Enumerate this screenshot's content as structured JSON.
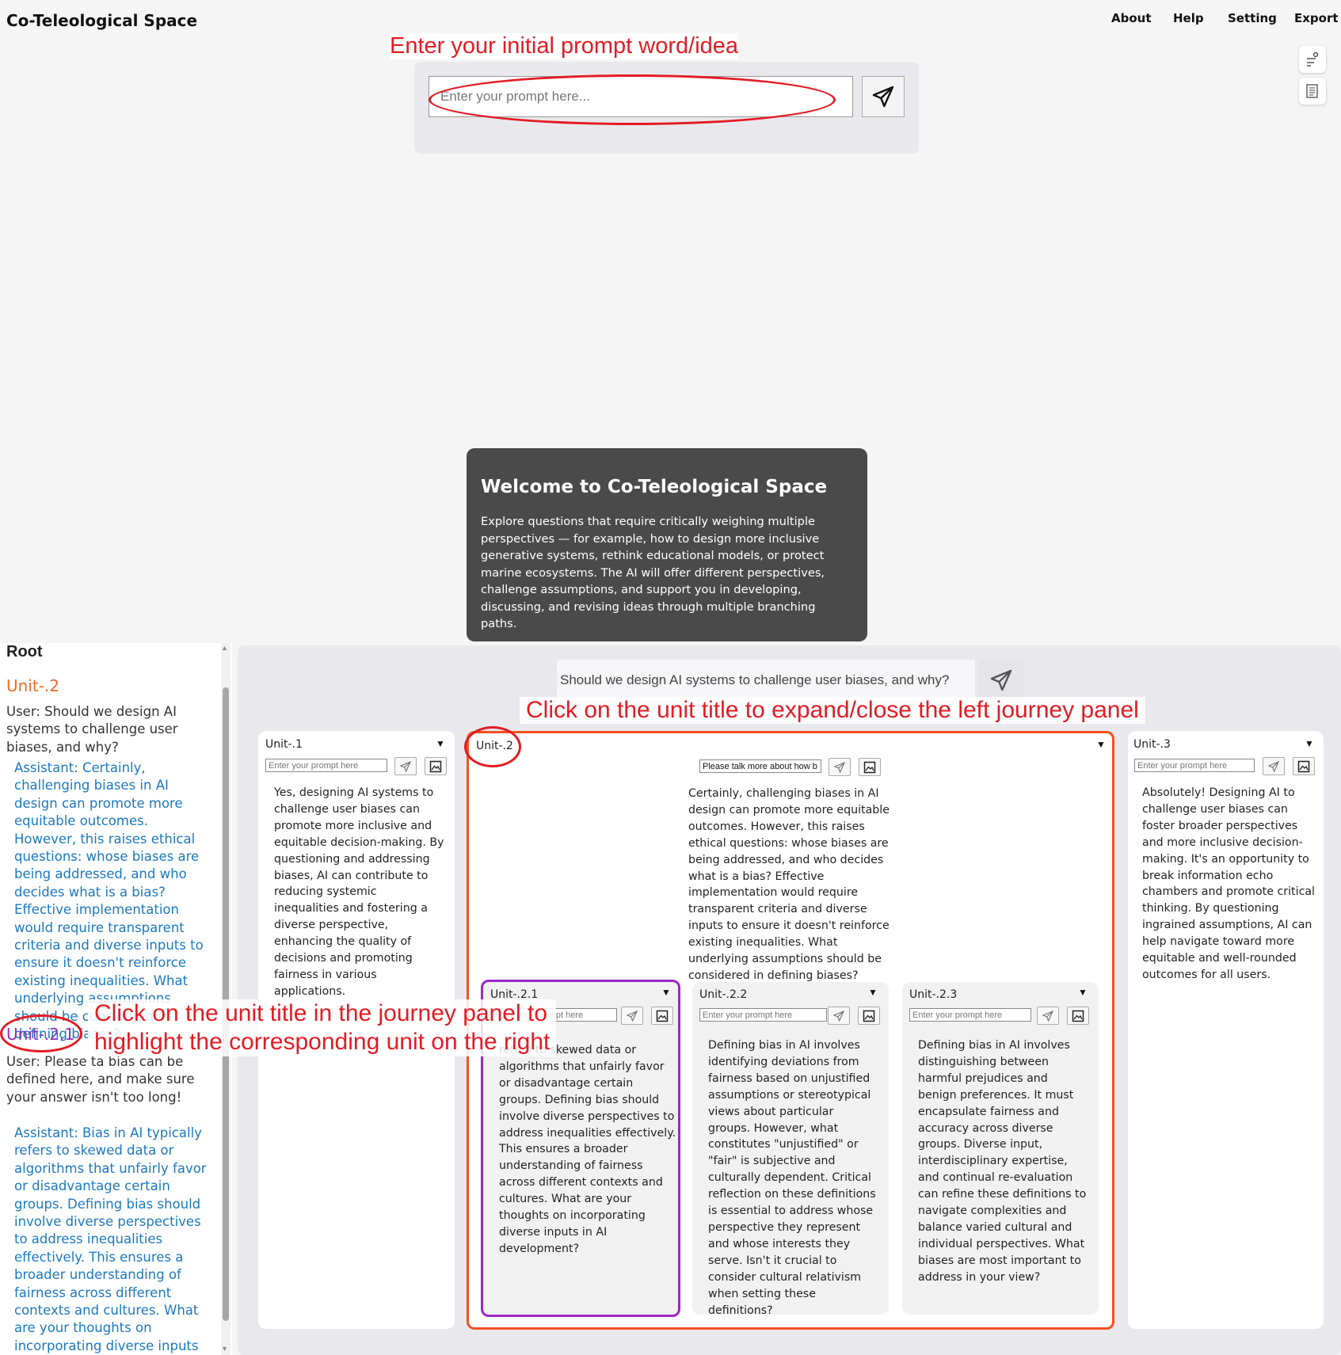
{
  "header": {
    "app_title": "Co-Teleological Space",
    "nav": [
      "About",
      "Help",
      "Setting",
      "Export"
    ]
  },
  "toolbar_icons": [
    "branch-icon",
    "notes-icon"
  ],
  "annotations": {
    "initial_prompt": "Enter your initial prompt word/idea",
    "expand_unit": "Click on the unit title to expand/close the left journey panel",
    "highlight_line1": "Click on the unit title in the journey panel to",
    "highlight_line2": "highlight the corresponding unit on the right"
  },
  "prompt": {
    "placeholder": "Enter your prompt here..."
  },
  "welcome": {
    "title": "Welcome to Co-Teleological Space",
    "body": "Explore questions that require critically weighing multiple perspectives — for example, how to design more inclusive generative systems, rethink educational models, or protect marine ecosystems. The AI will offer different perspectives, challenge assumptions, and support you in developing, discussing, and revising ideas through multiple branching paths."
  },
  "journey": {
    "root_label": "Root",
    "units": [
      {
        "title": "Unit-.2",
        "color": "#f06a24",
        "user": "User: Should we design AI systems to challenge user biases, and why?",
        "assistant": "Assistant: Certainly, challenging biases in AI design can promote more equitable outcomes. However, this raises ethical questions: whose biases are being addressed, and who decides what is a bias? Effective implementation would require transparent criteria and diverse inputs to ensure it doesn't reinforce existing inequalities. What underlying assumptions should be considered in defining biases?"
      },
      {
        "title": "Unit-.2.1",
        "color": "#8e2fb8",
        "user": "User: Please ta bias can be defined here, and make sure your answer isn't too long!",
        "assistant": "Assistant: Bias in AI typically refers to skewed data or algorithms that unfairly favor or disadvantage certain groups. Defining bias should involve diverse perspectives to address inequalities effectively. This ensures a broader understanding of fairness across different contexts and cultures. What are your thoughts on incorporating diverse inputs in AI development?"
      }
    ]
  },
  "workspace": {
    "question": "Should we design AI systems to challenge user biases, and why?",
    "unit_placeholder": "Enter your prompt here",
    "cards": {
      "u1": {
        "title": "Unit-.1",
        "text": "Yes, designing AI systems to challenge user biases can promote more inclusive and equitable decision-making. By questioning and addressing biases, AI can contribute to reducing systemic inequalities and fostering a diverse perspective, enhancing the quality of decisions and promoting fairness in various applications."
      },
      "u2": {
        "title": "Unit-.2",
        "input_value": "Please talk more about how b",
        "text": "Certainly, challenging biases in AI design can promote more equitable outcomes. However, this raises ethical questions: whose biases are being addressed, and who decides what is a bias? Effective implementation would require transparent criteria and diverse inputs to ensure it doesn't reinforce existing inequalities. What underlying assumptions should be considered in defining biases?"
      },
      "u3": {
        "title": "Unit-.3",
        "text": "Absolutely! Designing AI to challenge user biases can foster broader perspectives and more inclusive decision-making. It's an opportunity to break information echo chambers and promote critical thinking. By questioning ingrained assumptions, AI can help navigate toward more equitable and well-rounded outcomes for all users."
      },
      "u21": {
        "title": "Unit-.2.1",
        "text": "refers to skewed data or algorithms that unfairly favor or disadvantage certain groups. Defining bias should involve diverse perspectives to address inequalities effectively. This ensures a broader understanding of fairness across different contexts and cultures. What are your thoughts on incorporating diverse inputs in AI development?"
      },
      "u22": {
        "title": "Unit-.2.2",
        "text": "Defining bias in AI involves identifying deviations from fairness based on unjustified assumptions or stereotypical views about particular groups. However, what constitutes \"unjustified\" or \"fair\" is subjective and culturally dependent. Critical reflection on these definitions is essential to address whose perspective they represent and whose interests they serve. Isn't it crucial to consider cultural relativism when setting these definitions?"
      },
      "u23": {
        "title": "Unit-.2.3",
        "text": "Defining bias in AI involves distinguishing between harmful prejudices and benign preferences. It must encapsulate fairness and accuracy across diverse groups. Diverse input, interdisciplinary expertise, and continual re-evaluation can refine these definitions to navigate complexities and balance varied cultural and individual perspectives. What biases are most important to address in your view?"
      }
    }
  },
  "colors": {
    "annotation_red": "#e31b23",
    "expanded_border": "#f4511e",
    "highlight_border": "#9b27c8",
    "assistant_text": "#1c78c0",
    "unit_orange": "#f06a24",
    "unit_purple": "#8e2fb8"
  }
}
